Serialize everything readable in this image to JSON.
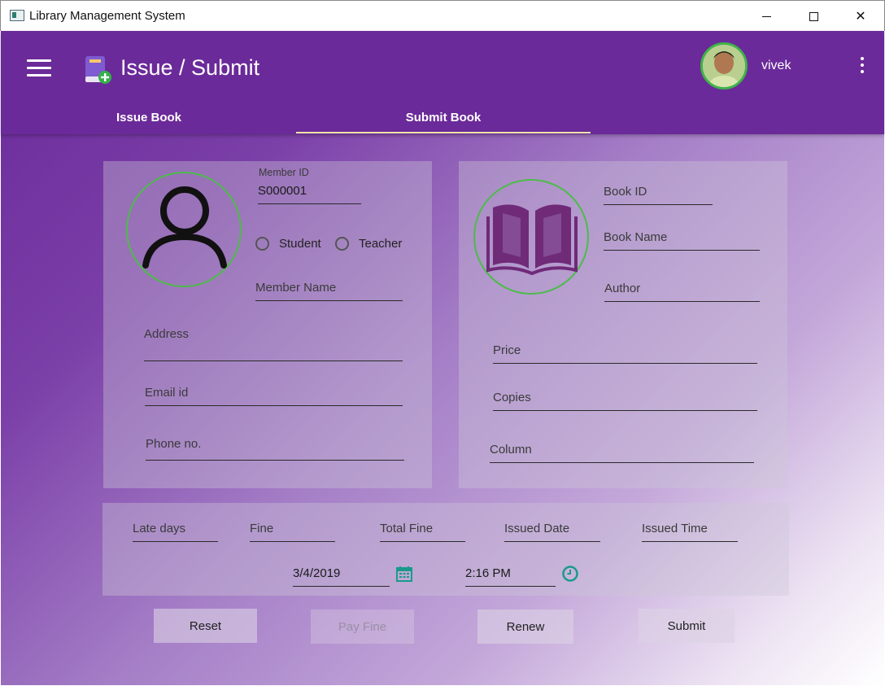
{
  "window": {
    "title": "Library Management System",
    "minimize": "",
    "maximize": "",
    "close": "✕"
  },
  "header": {
    "title": "Issue / Submit",
    "username": "vivek"
  },
  "tabs": [
    {
      "label": "Issue Book",
      "selected": false
    },
    {
      "label": "Submit Book",
      "selected": true
    }
  ],
  "member": {
    "id_label": "Member ID",
    "id_value": "S000001",
    "radio_student": "Student",
    "radio_teacher": "Teacher",
    "name_placeholder": "Member Name",
    "address_placeholder": "Address",
    "email_placeholder": "Email id",
    "phone_placeholder": "Phone no."
  },
  "book": {
    "id_placeholder": "Book ID",
    "name_placeholder": "Book Name",
    "author_placeholder": "Author",
    "price_placeholder": "Price",
    "copies_placeholder": "Copies",
    "column_placeholder": "Column"
  },
  "fine": {
    "late_days": "Late days",
    "fine": "Fine",
    "total_fine": "Total Fine",
    "issued_date": "Issued Date",
    "issued_time": "Issued Time",
    "date_value": "3/4/2019",
    "time_value": "2:16 PM"
  },
  "buttons": {
    "reset": "Reset",
    "pay_fine": "Pay Fine",
    "renew": "Renew",
    "submit": "Submit"
  },
  "colors": {
    "accent": "#6b2a99",
    "ring": "#4dbb4a",
    "tab_indicator": "#f3e6a8",
    "book_icon": "#6f2a78",
    "picker_icon": "#1a9a8a"
  },
  "icons": [
    "menu-icon",
    "book-add-icon",
    "avatar",
    "more-vert-icon",
    "user-icon",
    "open-book-icon",
    "calendar-icon",
    "clock-icon"
  ]
}
